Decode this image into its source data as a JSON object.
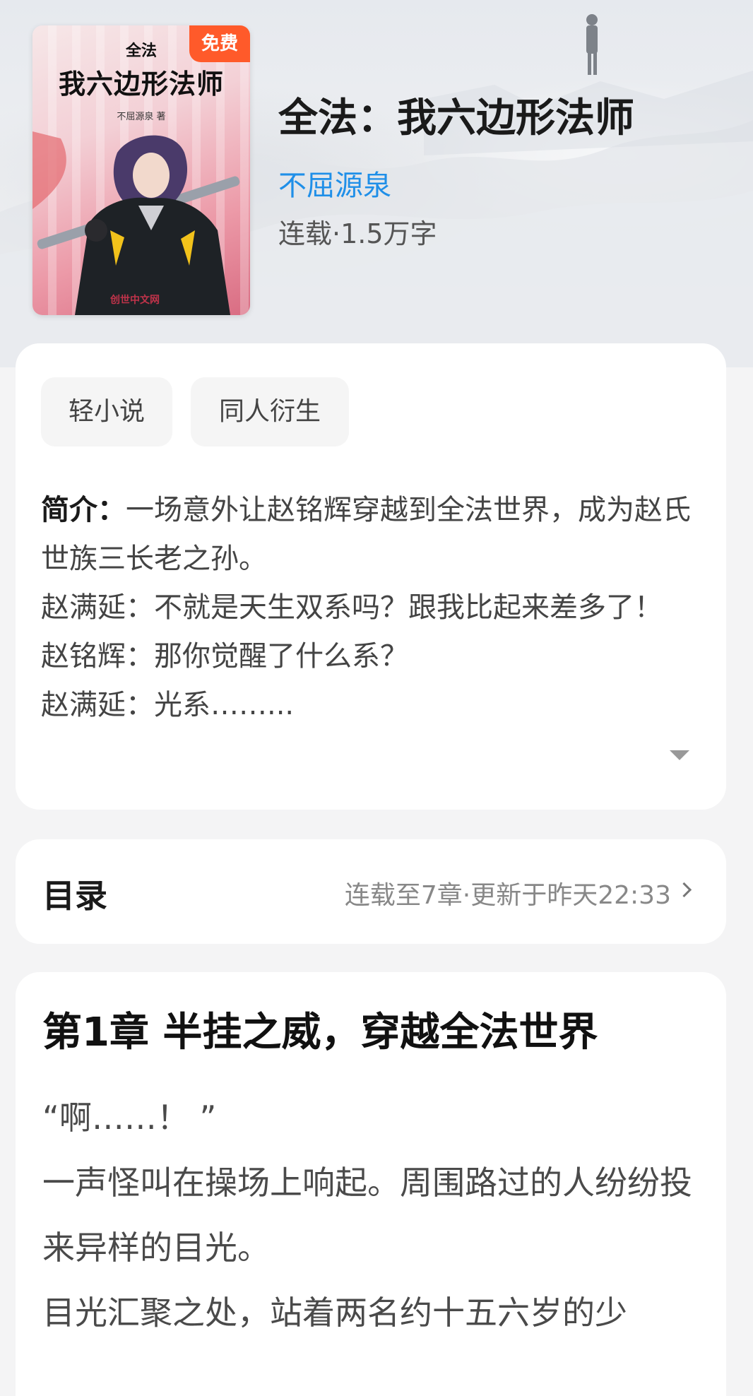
{
  "cover": {
    "small_title": "全法",
    "title": "我六边形法师",
    "author_line": "不屈源泉 著",
    "badge": "免费",
    "publisher_mark": "创世中文网"
  },
  "book": {
    "title": "全法：我六边形法师",
    "author": "不屈源泉",
    "status": "连载·1.5万字"
  },
  "tags": [
    "轻小说",
    "同人衍生"
  ],
  "intro": {
    "label": "简介：",
    "first": "一场意外让赵铭辉穿越到全法世界，成为赵氏世族三长老之孙。",
    "lines": [
      "赵满延：不就是天生双系吗？跟我比起来差多了！",
      "赵铭辉：那你觉醒了什么系？",
      "赵满延：光系……..."
    ]
  },
  "toc": {
    "title": "目录",
    "meta": "连载至7章·更新于昨天22:33"
  },
  "chapter": {
    "title": "第1章 半挂之威，穿越全法世界",
    "paragraphs": [
      "“啊……！ ”",
      "一声怪叫在操场上响起。周围路过的人纷纷投来异样的目光。",
      "目光汇聚之处，站着两名约十五六岁的少"
    ]
  },
  "colors": {
    "author_link": "#1f8fe8",
    "badge": "#ff5a2a",
    "card": "#ffffff",
    "page_bg": "#f4f4f5"
  }
}
